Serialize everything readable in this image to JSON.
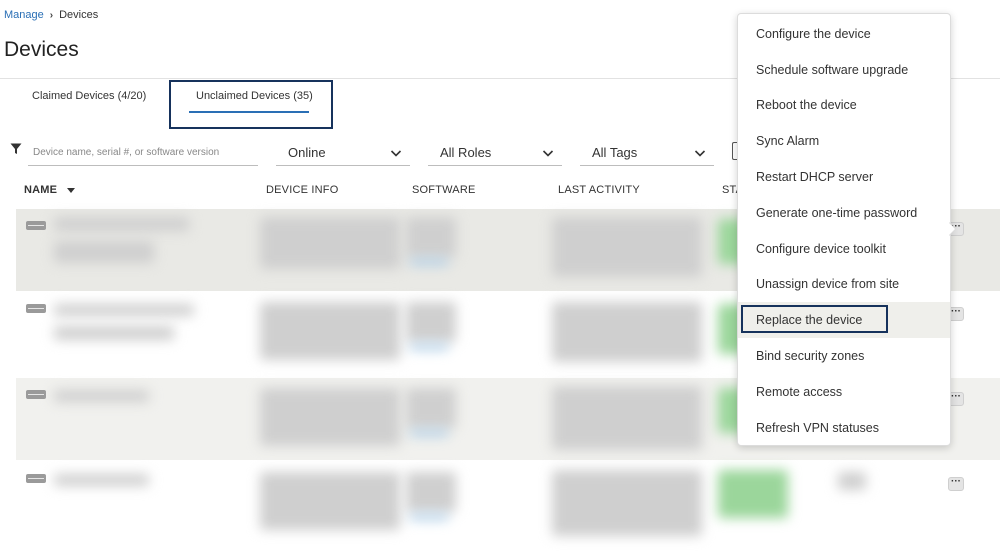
{
  "breadcrumb": {
    "parent": "Manage",
    "separator": "›",
    "current": "Devices"
  },
  "page_title": "Devices",
  "tabs": [
    {
      "label": "Claimed Devices (4/20)"
    },
    {
      "label": "Unclaimed Devices (35)",
      "active": true
    }
  ],
  "filters": {
    "search_placeholder": "Device name, serial #, or software version",
    "status": "Online",
    "roles": "All Roles",
    "tags": "All Tags"
  },
  "columns": {
    "name": "NAME",
    "device_info": "DEVICE INFO",
    "software": "SOFTWARE",
    "last_activity": "LAST ACTIVITY",
    "status": "STA"
  },
  "row_menu_label": "···",
  "context_menu": {
    "items": [
      "Configure the device",
      "Schedule software upgrade",
      "Reboot the device",
      "Sync Alarm",
      "Restart DHCP server",
      "Generate one-time password",
      "Configure device toolkit",
      "Unassign device from site",
      "Replace the device",
      "Bind security zones",
      "Remote access",
      "Refresh VPN statuses"
    ],
    "highlighted_item": "Replace the device"
  },
  "icons": {
    "breadcrumb_sep": "chevron-right-icon",
    "filter": "filter-icon",
    "dropdown": "chevron-down-icon",
    "sort": "sort-desc-icon",
    "device": "device-icon",
    "row_action": "more-icon"
  },
  "colors": {
    "link": "#2a6fb5",
    "highlight_border": "#16325c",
    "status_green": "#9bd69b",
    "row_shade": "#f1f1ee"
  }
}
